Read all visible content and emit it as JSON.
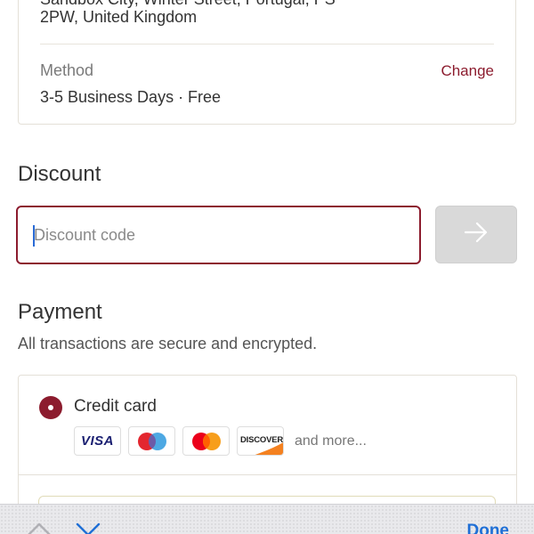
{
  "shipping": {
    "address_line1": "Sandbox City, Winter Street, Portugal, PS",
    "address_line2": "2PW, United Kingdom",
    "method_label": "Method",
    "method_value": "3-5 Business Days · Free",
    "change_label": "Change"
  },
  "discount": {
    "title": "Discount",
    "placeholder": "Discount code",
    "value": ""
  },
  "payment": {
    "title": "Payment",
    "subtitle": "All transactions are secure and encrypted.",
    "option_label": "Credit card",
    "and_more": "and more...",
    "logos": {
      "visa": "VISA",
      "discover": "DISCOVER"
    }
  },
  "keyboard": {
    "done_label": "Done"
  },
  "colors": {
    "accent": "#8c1c2e",
    "link_blue": "#1f6fd6",
    "disabled_button": "#d9d9d9"
  },
  "icons": {
    "apply": "arrow-right-icon",
    "prev": "chevron-up-icon",
    "next": "chevron-down-icon"
  }
}
